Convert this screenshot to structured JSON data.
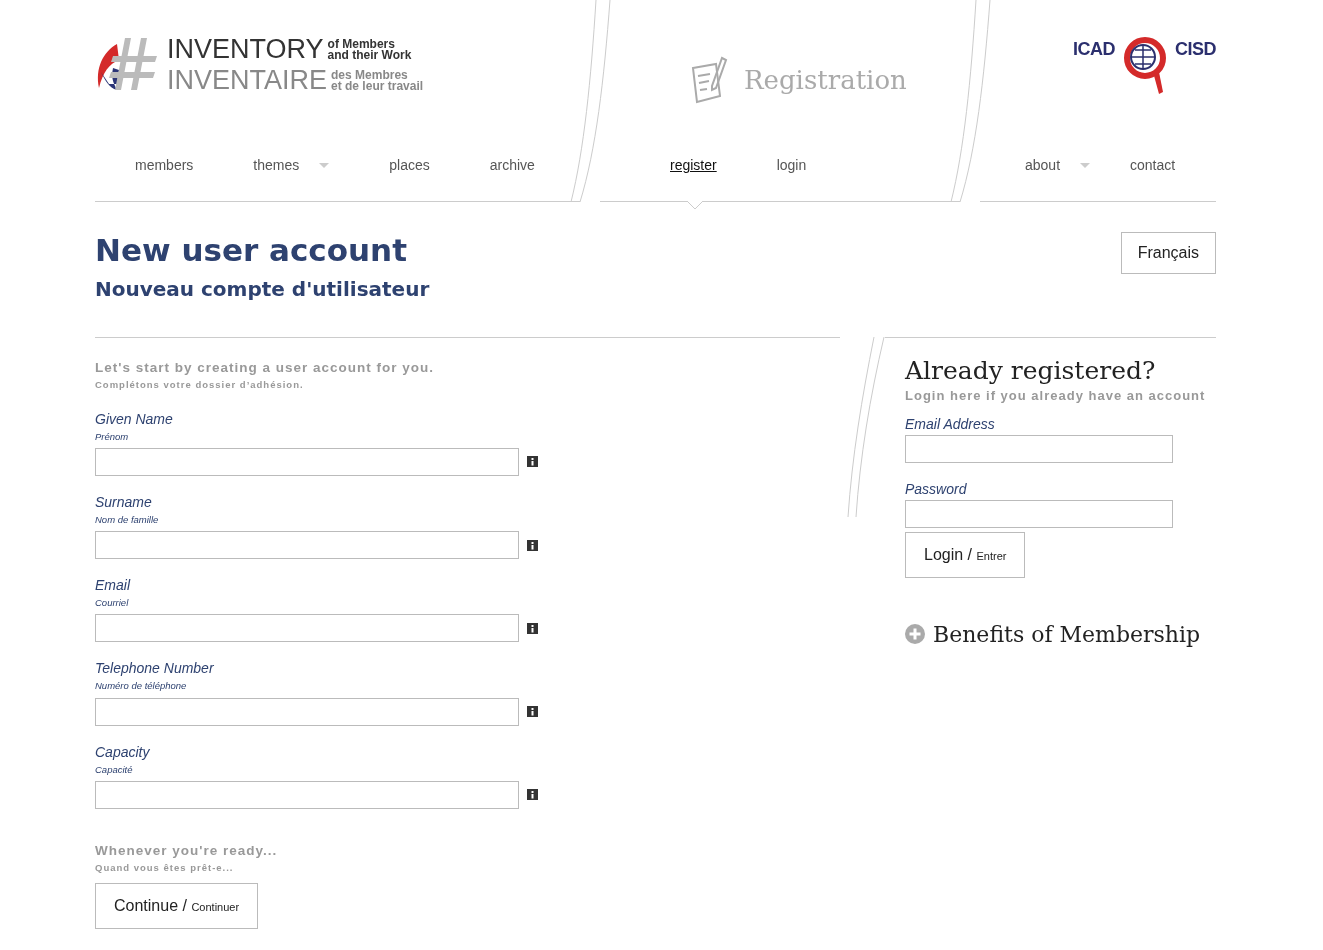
{
  "header": {
    "logo": {
      "title_en": "INVENTORY",
      "sub_en": [
        "of Members",
        "and their Work"
      ],
      "title_fr": "INVENTAIRE",
      "sub_fr": [
        "des Membres",
        "et de leur travail"
      ]
    },
    "section_title": "Registration",
    "partner_logo": {
      "left": "ICAD",
      "right": "CISD"
    }
  },
  "nav": {
    "main": [
      {
        "label": "members",
        "dropdown": false,
        "selected": false
      },
      {
        "label": "themes",
        "dropdown": true,
        "selected": false
      },
      {
        "label": "places",
        "dropdown": false,
        "selected": false
      },
      {
        "label": "archive",
        "dropdown": false,
        "selected": false
      }
    ],
    "account": [
      {
        "label": "register",
        "dropdown": false,
        "selected": true
      },
      {
        "label": "login",
        "dropdown": false,
        "selected": false
      }
    ],
    "info": [
      {
        "label": "about",
        "dropdown": true,
        "selected": false
      },
      {
        "label": "contact",
        "dropdown": false,
        "selected": false
      }
    ]
  },
  "page": {
    "title": "New user account",
    "subtitle": "Nouveau compte d'utilisateur",
    "language_button": "Français"
  },
  "register_form": {
    "intro": "Let's start by creating a user account for you.",
    "intro_fr": "Complétons votre dossier d’adhésion.",
    "fields": [
      {
        "label": "Given Name",
        "label_fr": "Prénom"
      },
      {
        "label": "Surname",
        "label_fr": "Nom de famille"
      },
      {
        "label": "Email",
        "label_fr": "Courriel"
      },
      {
        "label": "Telephone Number",
        "label_fr": "Numéro de téléphone"
      },
      {
        "label": "Capacity",
        "label_fr": "Capacité"
      }
    ],
    "ready": "Whenever you're ready...",
    "ready_fr": "Quand vous êtes prêt-e...",
    "button": {
      "label": "Continue",
      "separator": "/",
      "label_fr": "Continuer"
    }
  },
  "login": {
    "title": "Already registered?",
    "subtitle": "Login here if you already have an account",
    "fields": [
      {
        "label": "Email Address"
      },
      {
        "label": "Password"
      }
    ],
    "button": {
      "label": "Login",
      "separator": "/",
      "label_fr": "Entrer"
    },
    "benefits": "Benefits of Membership"
  }
}
